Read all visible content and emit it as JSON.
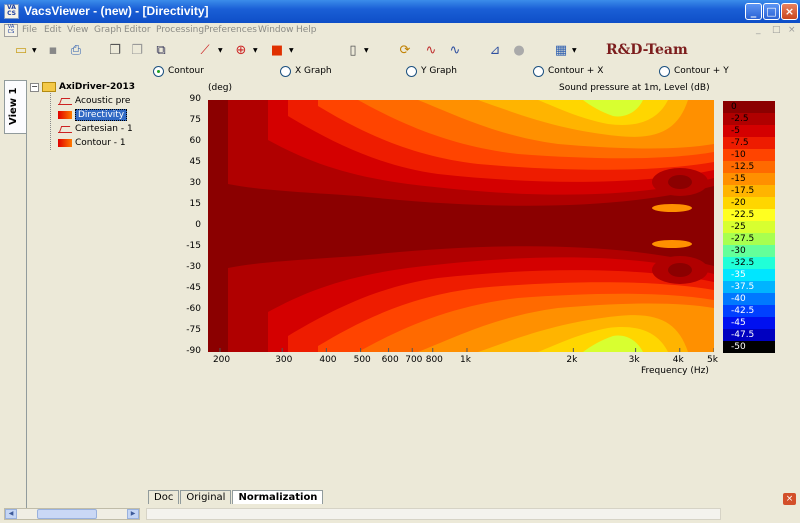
{
  "window": {
    "title": "VacsViewer - (new) - [Directivity]",
    "minimize_label": "_",
    "maximize_label": "□",
    "close_label": "×"
  },
  "menu": {
    "items": [
      "File",
      "Edit",
      "View",
      "Graph",
      "Editor",
      "Processing",
      "Preferences",
      "Window",
      "Help"
    ],
    "mdi_controls": [
      "_",
      "□",
      "×"
    ]
  },
  "toolbar": {
    "brand": "R&D-Team",
    "icons": [
      "open-folder",
      "save",
      "print",
      "copy-page",
      "paste-page",
      "duplicate",
      "line-graph",
      "polar-graph",
      "color-fill",
      "new-page",
      "reload",
      "ycurve",
      "spectrum",
      "stp-icon",
      "table"
    ]
  },
  "graph_modes": {
    "options": [
      "Contour",
      "X Graph",
      "Y Graph",
      "Contour + X",
      "Contour + Y"
    ],
    "selected": "Contour"
  },
  "view_tab": "View 1",
  "tree": {
    "root": "AxiDriver-2013",
    "children": [
      {
        "label": "Acoustic pre",
        "icon": "line"
      },
      {
        "label": "Directivity",
        "icon": "fill",
        "selected": true
      },
      {
        "label": "Cartesian - 1",
        "icon": "line"
      },
      {
        "label": "Contour - 1",
        "icon": "fill"
      }
    ]
  },
  "bottom_tabs": {
    "items": [
      "Doc",
      "Original",
      "Normalization"
    ],
    "active": "Normalization",
    "close_label": "×"
  },
  "chart_data": {
    "type": "heatmap",
    "title": "Sound pressure at 1m, Level  (dB)",
    "ylabel": "(deg)",
    "xlabel": "Frequency  (Hz)",
    "x_scale": "log",
    "xlim": [
      185,
      5000
    ],
    "ylim": [
      -90,
      90
    ],
    "x_ticks": [
      {
        "label": "200",
        "value": 200
      },
      {
        "label": "300",
        "value": 300
      },
      {
        "label": "400",
        "value": 400
      },
      {
        "label": "500",
        "value": 500
      },
      {
        "label": "600",
        "value": 600
      },
      {
        "label": "700",
        "value": 700
      },
      {
        "label": "800",
        "value": 800
      },
      {
        "label": "1k",
        "value": 1000
      },
      {
        "label": "2k",
        "value": 2000
      },
      {
        "label": "3k",
        "value": 3000
      },
      {
        "label": "4k",
        "value": 4000
      },
      {
        "label": "5k",
        "value": 5000
      }
    ],
    "y_ticks": [
      90,
      75,
      60,
      45,
      30,
      15,
      0,
      -15,
      -30,
      -45,
      -60,
      -75,
      -90
    ],
    "colorbar": {
      "levels": [
        "0",
        "-2.5",
        "-5",
        "-7.5",
        "-10",
        "-12.5",
        "-15",
        "-17.5",
        "-20",
        "-22.5",
        "-25",
        "-27.5",
        "-30",
        "-32.5",
        "-35",
        "-37.5",
        "-40",
        "-42.5",
        "-45",
        "-47.5",
        "-50"
      ],
      "colors": [
        "#8b0000",
        "#b00000",
        "#d40000",
        "#ee1c00",
        "#ff4400",
        "#ff6a00",
        "#ff9000",
        "#ffb400",
        "#ffd600",
        "#ffff20",
        "#d8ff30",
        "#a8ff50",
        "#64ff9a",
        "#20ffd8",
        "#00e6ff",
        "#00b4ff",
        "#0078ff",
        "#0040ff",
        "#0010f0",
        "#0000c0",
        "#000000"
      ]
    },
    "notes": "Frequency-angle directivity: 0 dB over the central beam, narrowing above ~800 Hz; off-axis level falls toward -20..-25 dB near ±90° around 2.5–3 kHz; lobes near ±15° and ±35° at ~4 kHz."
  }
}
